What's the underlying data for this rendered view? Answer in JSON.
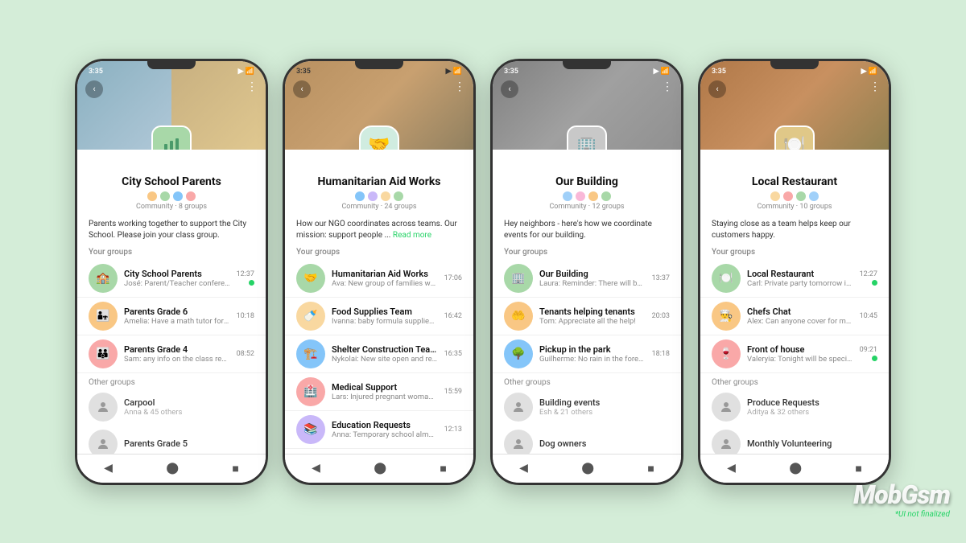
{
  "watermark": {
    "text": "MobGsm",
    "note": "*UI not finalized"
  },
  "phones": [
    {
      "id": "phone1",
      "status_time": "3:35",
      "community": {
        "name": "City School Parents",
        "meta": "Community · 8 groups",
        "description": "Parents working together to support the City School. Please join your class group.",
        "avatar_color": "#c8d8b0"
      },
      "your_groups_label": "Your groups",
      "groups": [
        {
          "name": "City School Parents",
          "preview": "José: Parent/Teacher conferences ...",
          "time": "12:37",
          "unread": true,
          "avatar_color": "#a8d8a8"
        },
        {
          "name": "Parents Grade 6",
          "preview": "Amelia: Have a math tutor for the upco...",
          "time": "10:18",
          "unread": false,
          "avatar_color": "#f9c784"
        },
        {
          "name": "Parents Grade 4",
          "preview": "Sam: any info on the class recital?",
          "time": "08:52",
          "unread": false,
          "avatar_color": "#f9a8a8"
        }
      ],
      "other_groups_label": "Other groups",
      "other_groups": [
        {
          "name": "Carpool",
          "sub": "Anna & 45 others"
        },
        {
          "name": "Parents Grade 5",
          "sub": ""
        }
      ]
    },
    {
      "id": "phone2",
      "status_time": "3:35",
      "community": {
        "name": "Humanitarian Aid Works",
        "meta": "Community · 24 groups",
        "description": "How our NGO coordinates across teams. Our mission: support people ...",
        "avatar_color": "#d0e8d0",
        "has_read_more": true
      },
      "your_groups_label": "Your groups",
      "groups": [
        {
          "name": "Humanitarian Aid Works",
          "preview": "Ava: New group of families waiting ...",
          "time": "17:06",
          "unread": false,
          "avatar_color": "#a8d8a8"
        },
        {
          "name": "Food Supplies Team",
          "preview": "Ivanna: baby formula supplies running ...",
          "time": "16:42",
          "unread": false,
          "avatar_color": "#f9c784"
        },
        {
          "name": "Shelter Construction Team",
          "preview": "Nykolai: New site open and ready for ...",
          "time": "16:35",
          "unread": false,
          "avatar_color": "#84c5f9"
        },
        {
          "name": "Medical Support",
          "preview": "Lars: Injured pregnant woman in need ...",
          "time": "15:59",
          "unread": false,
          "avatar_color": "#f9a8a8"
        },
        {
          "name": "Education Requests",
          "preview": "Anna: Temporary school almost comp...",
          "time": "12:13",
          "unread": false,
          "avatar_color": "#c9b8f9"
        }
      ],
      "other_groups_label": "",
      "other_groups": []
    },
    {
      "id": "phone3",
      "status_time": "3:35",
      "community": {
        "name": "Our Building",
        "meta": "Community · 12 groups",
        "description": "Hey neighbors - here's how we coordinate events for our building.",
        "avatar_color": "#c8c8c8"
      },
      "your_groups_label": "Your groups",
      "groups": [
        {
          "name": "Our Building",
          "preview": "Laura: Reminder: There will be ...",
          "time": "13:37",
          "unread": false,
          "avatar_color": "#a8d8a8",
          "has_pin": true
        },
        {
          "name": "Tenants helping tenants",
          "preview": "Tom: Appreciate all the help!",
          "time": "20:03",
          "unread": false,
          "avatar_color": "#f9c784"
        },
        {
          "name": "Pickup in the park",
          "preview": "Guilherme: No rain in the forecast!",
          "time": "18:18",
          "unread": false,
          "avatar_color": "#84c5f9"
        }
      ],
      "other_groups_label": "Other groups",
      "other_groups": [
        {
          "name": "Building events",
          "sub": "Esh & 21 others"
        },
        {
          "name": "Dog owners",
          "sub": ""
        }
      ]
    },
    {
      "id": "phone4",
      "status_time": "3:35",
      "community": {
        "name": "Local Restaurant",
        "meta": "Community · 10 groups",
        "description": "Staying close as a team helps keep our customers happy.",
        "avatar_color": "#d0c090"
      },
      "your_groups_label": "Your groups",
      "groups": [
        {
          "name": "Local Restaurant",
          "preview": "Carl: Private party tomorrow in the ...",
          "time": "12:27",
          "unread": true,
          "avatar_color": "#a8d8a8"
        },
        {
          "name": "Chefs Chat",
          "preview": "Alex: Can anyone cover for me?",
          "time": "10:45",
          "unread": false,
          "avatar_color": "#f9c784"
        },
        {
          "name": "Front of house",
          "preview": "Valeryia: Tonight will be special!",
          "time": "09:21",
          "unread": true,
          "avatar_color": "#f9a8a8"
        }
      ],
      "other_groups_label": "Other groups",
      "other_groups": [
        {
          "name": "Produce Requests",
          "sub": "Aditya & 32 others"
        },
        {
          "name": "Monthly Volunteering",
          "sub": ""
        }
      ]
    }
  ]
}
